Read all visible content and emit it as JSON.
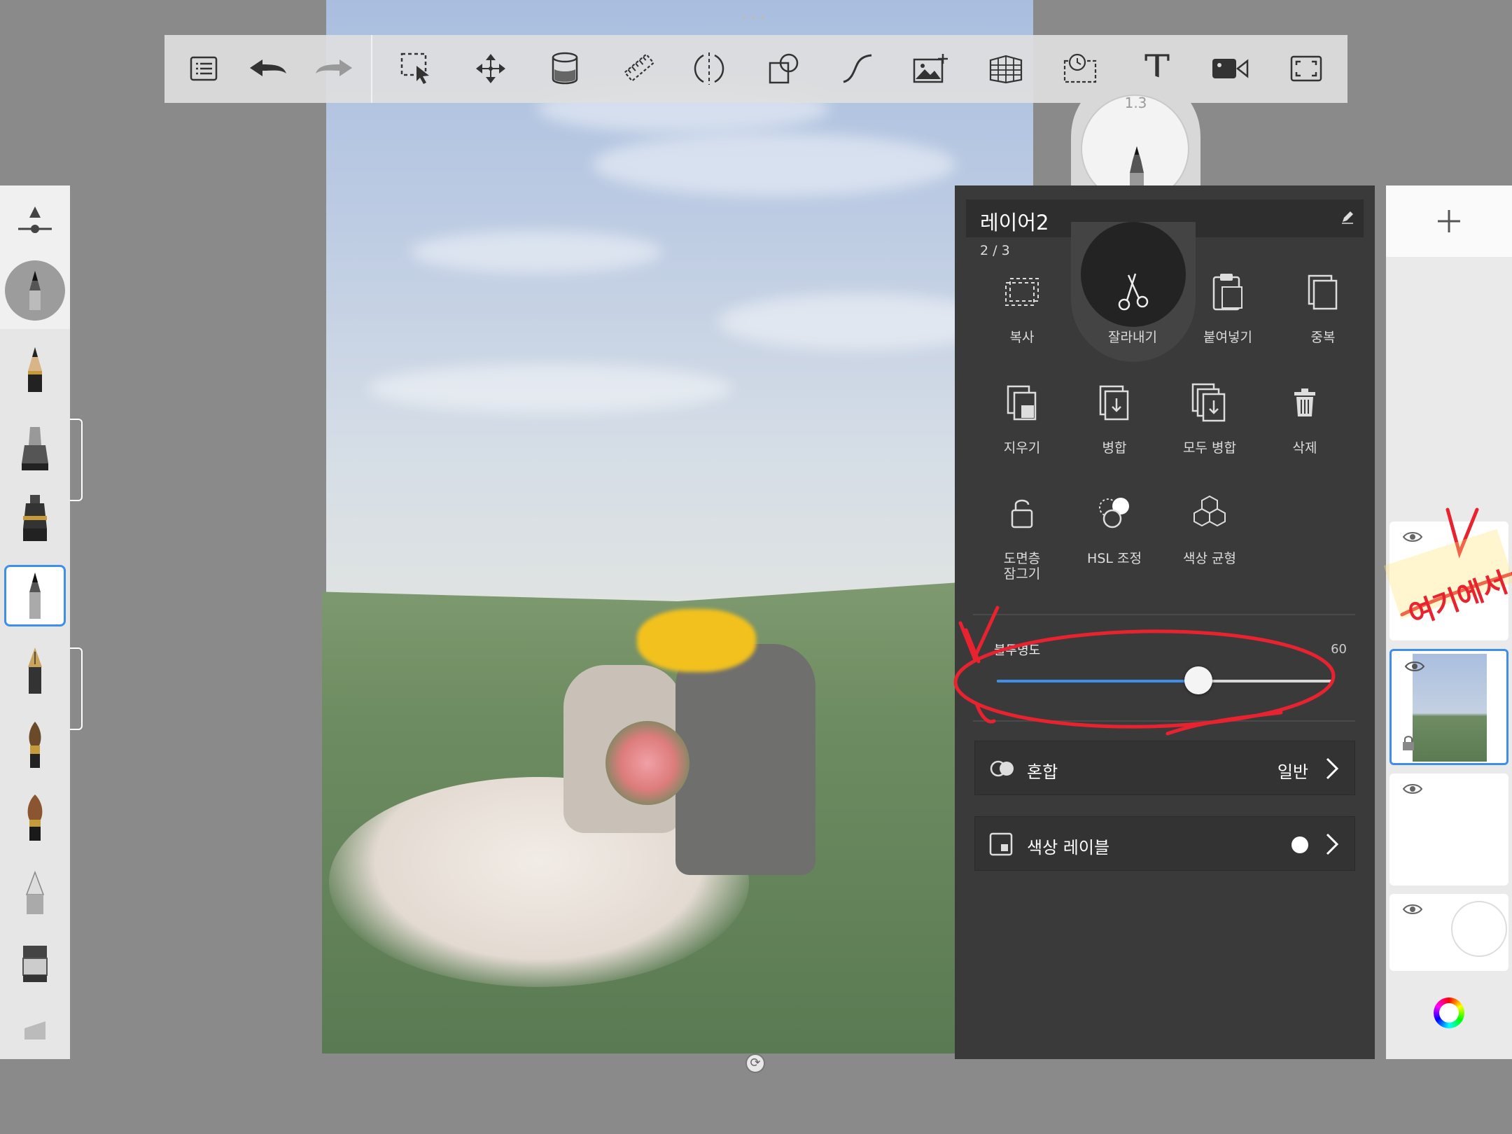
{
  "toolbar": {
    "items": [
      "list-icon",
      "undo-icon",
      "redo-icon",
      "selection-icon",
      "move-icon",
      "fill-bucket-icon",
      "ruler-icon",
      "symmetry-icon",
      "shapes-icon",
      "curve-icon",
      "image-add-icon",
      "perspective-grid-icon",
      "timelapse-icon",
      "text-icon",
      "video-icon",
      "fullscreen-icon"
    ],
    "text_glyph": "T"
  },
  "brush_puck": {
    "size": "1.3"
  },
  "layer_menu": {
    "layer_name": "레이어2",
    "index": "2 / 3",
    "actions": [
      {
        "label": "복사",
        "icon": "copy-icon"
      },
      {
        "label": "잘라내기",
        "icon": "scissors-icon",
        "selected": true
      },
      {
        "label": "붙여넣기",
        "icon": "paste-icon"
      },
      {
        "label": "중복",
        "icon": "duplicate-icon"
      },
      {
        "label": "지우기",
        "icon": "clear-icon"
      },
      {
        "label": "병합",
        "icon": "merge-icon"
      },
      {
        "label": "모두 병합",
        "icon": "merge-all-icon"
      },
      {
        "label": "삭제",
        "icon": "trash-icon"
      },
      {
        "label_line1": "도면층",
        "label_line2": "잠그기",
        "icon": "lock-icon"
      },
      {
        "label": "HSL 조정",
        "icon": "hsl-icon"
      },
      {
        "label": "색상 균형",
        "icon": "color-balance-icon"
      }
    ],
    "opacity": {
      "label": "불투명도",
      "value": "60",
      "fraction": 0.6
    },
    "blend": {
      "label": "혼합",
      "value": "일반"
    },
    "color_label": {
      "label": "색상 레이블",
      "color": "#ffffff"
    }
  },
  "annotation": {
    "text": "여기에서",
    "color": "#e8232f"
  },
  "colors": {
    "accent": "#3f8fe8",
    "panel": "#3a3a3a",
    "face_blur": "#f2c11e"
  }
}
